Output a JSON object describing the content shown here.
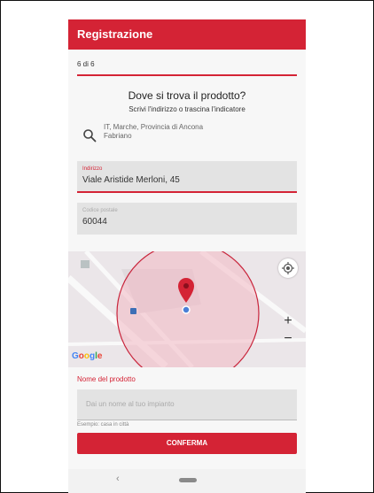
{
  "header": {
    "title": "Registrazione"
  },
  "progress": {
    "step_text": "6 di 6"
  },
  "question": {
    "title": "Dove si trova il prodotto?",
    "subtitle": "Scrivi l'indirizzo o trascina l'indicatore"
  },
  "search": {
    "line1": "IT, Marche, Provincia di Ancona",
    "line2": "Fabriano",
    "icon": "search-icon"
  },
  "address_field": {
    "label": "Indirizzo",
    "value": "Viale Aristide Merloni, 45"
  },
  "postal_field": {
    "label": "Codice postale",
    "value": "60044"
  },
  "map": {
    "attribution": "Google",
    "zoom_in": "+",
    "zoom_out": "−",
    "accent": "#d42335"
  },
  "product_name": {
    "label": "Nome del prodotto",
    "placeholder": "Dai un nome al tuo impianto",
    "helper": "Esempio: casa in città"
  },
  "confirm_button": {
    "label": "CONFERMA"
  },
  "system_nav": {
    "back": "‹"
  },
  "colors": {
    "brand": "#d42335",
    "field_bg": "#e3e3e3"
  }
}
